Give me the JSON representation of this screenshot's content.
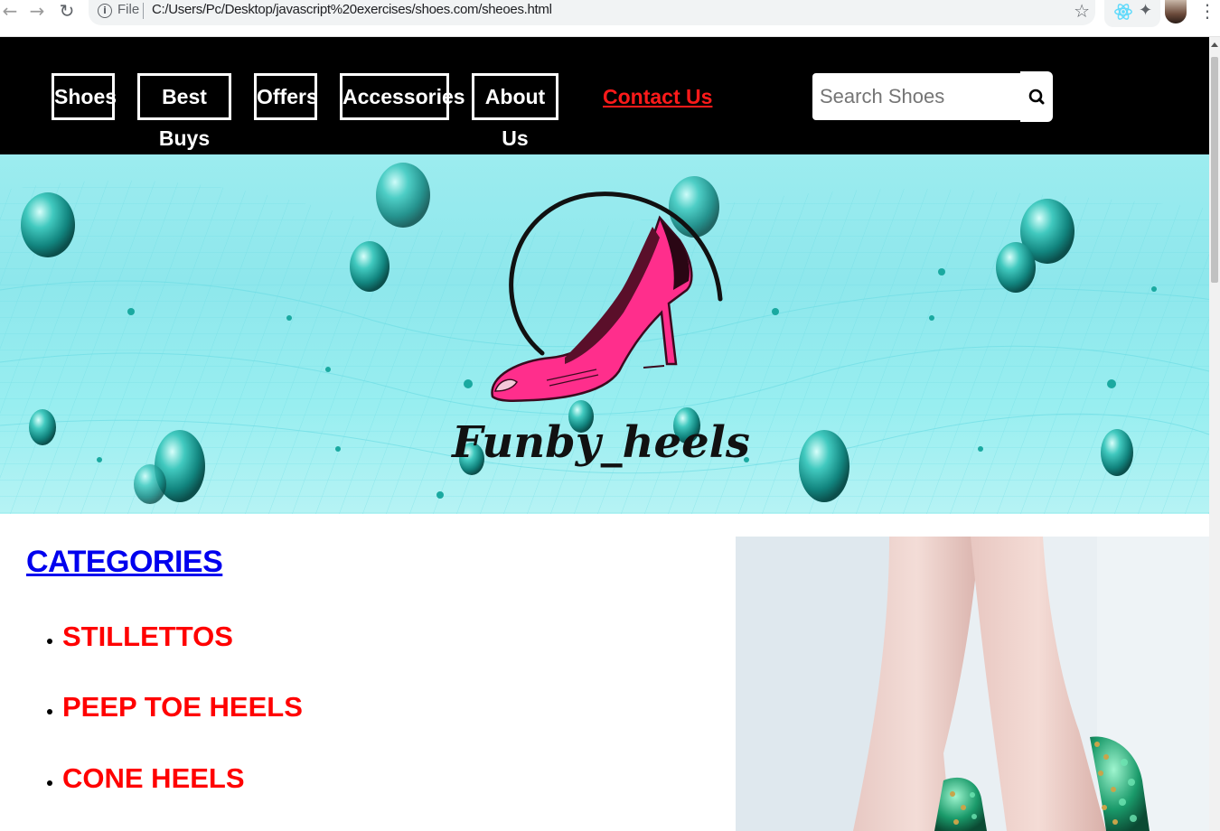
{
  "browser": {
    "scheme_label": "File",
    "url": "C:/Users/Pc/Desktop/javascript%20exercises/shoes.com/sheoes.html"
  },
  "nav": {
    "items": [
      {
        "label": "Shoes"
      },
      {
        "label": "Best Buys"
      },
      {
        "label": "Offers"
      },
      {
        "label": "Accessories"
      },
      {
        "label": "About Us"
      }
    ],
    "contact_label": "Contact Us"
  },
  "search": {
    "placeholder": "Search Shoes",
    "icon": "search-icon"
  },
  "banner": {
    "brand": "Funby_heels",
    "logo_icon": "high-heel-shoe",
    "colors": {
      "background": "#94e9ee",
      "shoe": "#ff2e8c",
      "ink": "#111111"
    }
  },
  "categories": {
    "title": "CATEGORIES",
    "items": [
      {
        "label": "STILLETTOS"
      },
      {
        "label": "PEEP TOE HEELS"
      },
      {
        "label": "CONE HEELS"
      }
    ]
  },
  "colors": {
    "nav_bg": "#000000",
    "nav_text": "#ffffff",
    "contact": "#ff1a1a",
    "category_title": "#0000ee",
    "category_item": "#ff0000"
  }
}
